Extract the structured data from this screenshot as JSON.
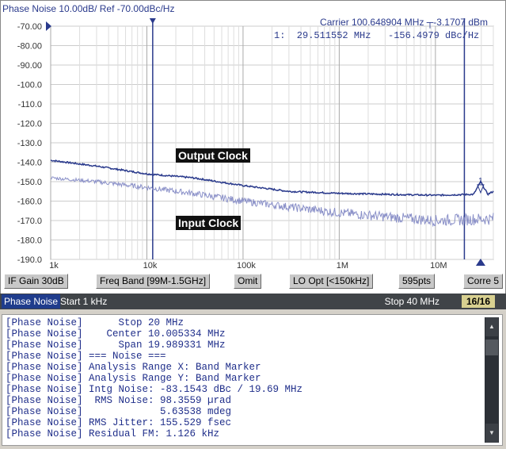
{
  "chart_panel": {
    "title": "Phase Noise 10.00dB/ Ref -70.00dBc/Hz",
    "carrier": "Carrier 100.648904 MHz ┬-3.1707 dBm",
    "marker_readout": "1:  29.511552 MHz   -156.4979 dBc/Hz",
    "marker_number": "1",
    "trace_labels": [
      "Output Clock",
      "Input Clock"
    ]
  },
  "chart_data": {
    "type": "line",
    "x_scale": "log",
    "xlim": [
      1000,
      40000000
    ],
    "ylim": [
      -190,
      -70
    ],
    "y_ticks": [
      "-70.00",
      "-80.00",
      "-90.00",
      "-100.0",
      "-110.0",
      "-120.0",
      "-130.0",
      "-140.0",
      "-150.0",
      "-160.0",
      "-170.0",
      "-180.0",
      "-190.0"
    ],
    "x_ticks": [
      "1k",
      "10k",
      "100k",
      "1M",
      "10M"
    ],
    "grid": true,
    "series": [
      {
        "name": "Output Clock",
        "color": "#2a3a8c",
        "x": [
          1000,
          3000,
          10000,
          30000,
          100000,
          300000,
          1000000,
          3000000,
          10000000,
          25000000,
          29511552,
          35000000,
          40000000
        ],
        "y": [
          -139,
          -142,
          -146,
          -148,
          -152,
          -155,
          -156,
          -156.5,
          -157,
          -156.5,
          -150,
          -156.5,
          -155
        ]
      },
      {
        "name": "Input Clock",
        "color": "#8a90c8",
        "x": [
          1000,
          3000,
          10000,
          30000,
          100000,
          300000,
          1000000,
          3000000,
          10000000,
          40000000
        ],
        "y": [
          -148,
          -150,
          -153,
          -156,
          -160,
          -163,
          -166,
          -168,
          -170,
          -169
        ]
      }
    ],
    "band_markers": [
      11500,
      20000000
    ],
    "marker": {
      "x": 29511552,
      "y": -156.4979
    }
  },
  "buttons": [
    "IF Gain 30dB",
    "Freq Band [99M-1.5GHz]",
    "Omit",
    "LO Opt [<150kHz]",
    "595pts",
    "Corre 5"
  ],
  "status": {
    "mode": "Phase Noise",
    "start": "Start 1 kHz",
    "stop": "Stop 40 MHz",
    "count": "16/16"
  },
  "log": [
    "[Phase Noise]      Stop 20 MHz",
    "[Phase Noise]    Center 10.005334 MHz",
    "[Phase Noise]      Span 19.989331 MHz",
    "[Phase Noise] === Noise ===",
    "[Phase Noise] Analysis Range X: Band Marker",
    "[Phase Noise] Analysis Range Y: Band Marker",
    "[Phase Noise] Intg Noise: -83.1543 dBc / 19.69 MHz",
    "[Phase Noise]  RMS Noise: 98.3559 µrad",
    "[Phase Noise]             5.63538 mdeg",
    "[Phase Noise] RMS Jitter: 155.529 fsec",
    "[Phase Noise] Residual FM: 1.126 kHz"
  ],
  "scrollbar": {
    "up": "▲",
    "down": "▼"
  }
}
